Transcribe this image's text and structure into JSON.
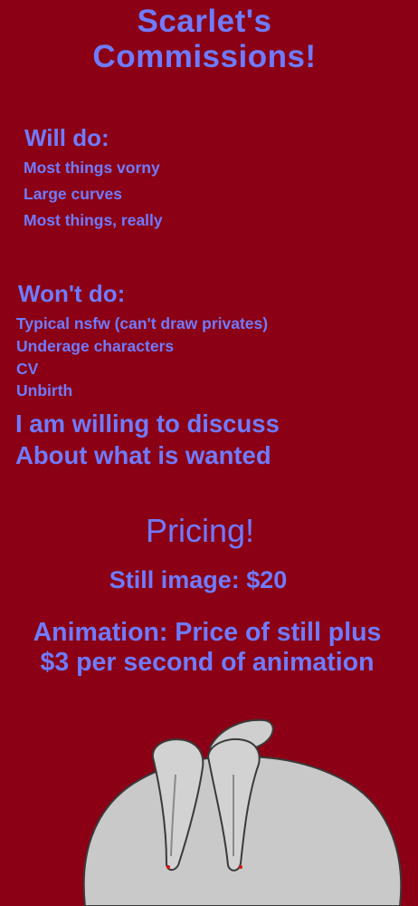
{
  "header": {
    "title_line1": "Scarlet's",
    "title_line2": "Commissions!"
  },
  "will_do": {
    "heading": "Will do:",
    "items": [
      "Most things vorny",
      "Large curves",
      "Most things, really"
    ]
  },
  "wont_do": {
    "heading": "Won't do:",
    "items": [
      "Typical nsfw (can't draw privates)",
      "Underage characters",
      "CV",
      "Unbirth"
    ]
  },
  "discuss": {
    "line1": "I am willing to discuss",
    "line2": "About what is wanted"
  },
  "pricing": {
    "heading": "Pricing!",
    "still": "Still image: $20",
    "animation_line1": "Animation: Price of still plus",
    "animation_line2": "$3 per second of animation"
  },
  "colors": {
    "background": "#8b0014",
    "text": "#6f7bff",
    "blob": "#c9c9c9"
  },
  "illustration": {
    "icon": "bunny-blob-character"
  }
}
